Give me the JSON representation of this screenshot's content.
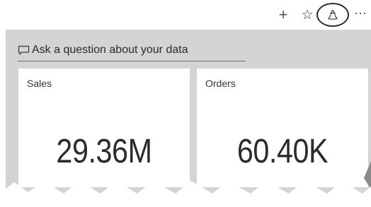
{
  "toolbar": {
    "add_icon": "plus-icon",
    "favorite_icon": "star-outline-icon",
    "focus_icon": "focus-mode-icon",
    "more_icon": "ellipsis-icon",
    "add_glyph": "+",
    "favorite_glyph": "☆",
    "more_glyph": "⋯"
  },
  "qa": {
    "icon": "chat-bubble-icon",
    "text": "Ask a question about your data"
  },
  "tiles": [
    {
      "title": "Sales",
      "value": "29.36M"
    },
    {
      "title": "Orders",
      "value": "60.40K"
    }
  ],
  "colors": {
    "canvas": "#d4d4d4",
    "tile": "#ffffff",
    "text": "#2b2b2b",
    "highlight_ring": "#2b2b2b"
  }
}
